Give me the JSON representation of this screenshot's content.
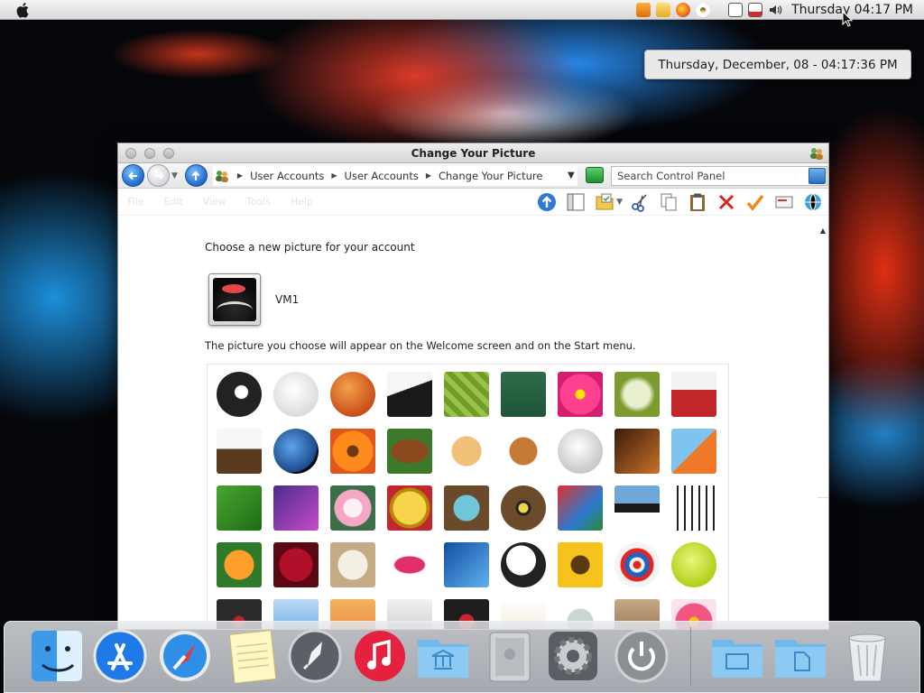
{
  "menubar": {
    "clock": "Thursday 04:17 PM",
    "tray_icons": [
      "media-player-icon",
      "folder-icon",
      "firefox-icon",
      "chrome-icon",
      "network-icon",
      "battery-icon",
      "volume-icon"
    ]
  },
  "tooltip": {
    "text": "Thursday, December, 08 - 04:17:36 PM"
  },
  "window": {
    "title": "Change Your Picture",
    "breadcrumb": [
      "User Accounts",
      "User Accounts",
      "Change Your Picture"
    ],
    "search_placeholder": "Search Control Panel",
    "menu_ghost": [
      "File",
      "Edit",
      "View",
      "Tools",
      "Help"
    ],
    "heading": "Choose a new picture for your account",
    "username": "VM1",
    "description": "The picture you choose will appear on the Welcome screen and on the Start menu."
  },
  "gallery": {
    "pictures": [
      [
        "8-ball",
        "baseball",
        "basketball",
        "bowling",
        "cactus",
        "chalkboard",
        "pink-flower",
        "dandelion",
        "drum"
      ],
      [
        "eagle",
        "earth",
        "orange-daisy",
        "football",
        "fortune-cookie",
        "gingerbread-man",
        "golf-ball",
        "guitar",
        "hockey"
      ],
      [
        "leaf",
        "lightning",
        "lotus",
        "gold-coin",
        "nest-eggs",
        "owl",
        "parrot",
        "penguin",
        "piano"
      ],
      [
        "poppy",
        "red-rose",
        "sand-dollar",
        "lips",
        "snowflake",
        "soccer-ball",
        "sunflower",
        "target",
        "tennis-ball"
      ],
      [
        "turntable",
        "rollercoaster",
        "starfish",
        "robot",
        "record-player",
        "lucky-cat",
        "sprocket",
        "kitten",
        "pink-daisy"
      ]
    ]
  },
  "dock": {
    "items": [
      "finder-icon",
      "app-store-icon",
      "safari-icon",
      "notes-icon",
      "launchpad-icon",
      "itunes-icon",
      "applications-folder-icon",
      "mac-pro-icon",
      "system-preferences-icon",
      "shutdown-icon",
      "documents-folder-icon",
      "downloads-folder-icon",
      "trash-icon"
    ]
  }
}
